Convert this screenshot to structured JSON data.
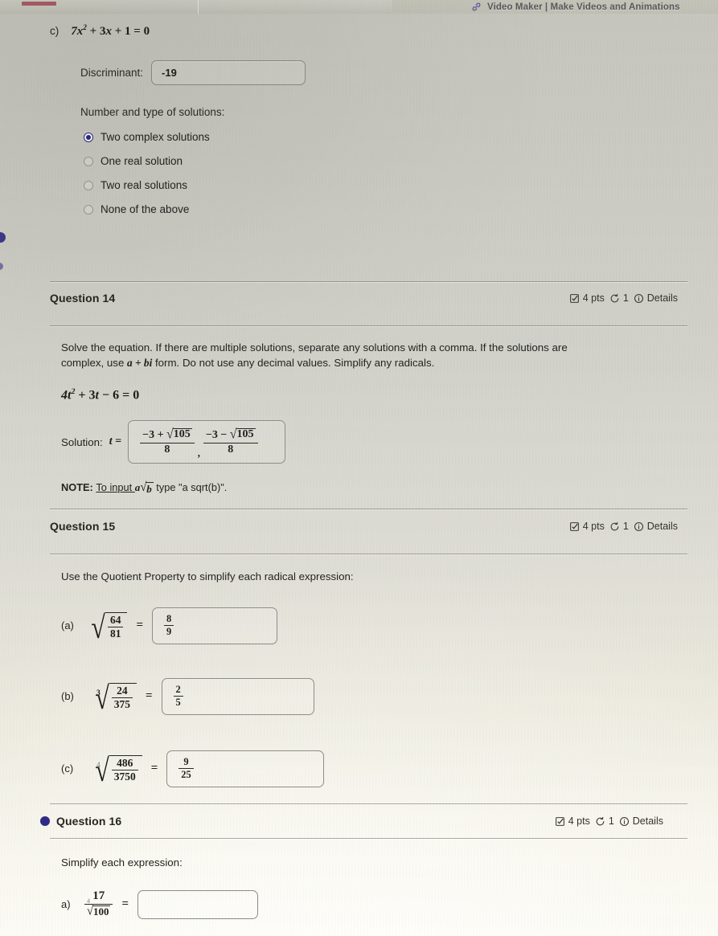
{
  "topbar": {
    "title": "Video Maker | Make Videos and Animations",
    "link_icon": "link-icon"
  },
  "part_c": {
    "label": "c)",
    "equation": {
      "coef_a": "7",
      "var": "x",
      "exponent": "2",
      "term_b": "+ 3",
      "var_b": "x",
      "term_c": "+ 1",
      "equals": "= 0"
    },
    "equation_text": "7x² + 3x + 1 = 0",
    "discriminant_label": "Discriminant:",
    "discriminant_value": "-19",
    "solutions_prompt": "Number and type of solutions:",
    "options": [
      {
        "label": "Two complex solutions",
        "selected": true
      },
      {
        "label": "One real solution",
        "selected": false
      },
      {
        "label": "Two real solutions",
        "selected": false
      },
      {
        "label": "None of the above",
        "selected": false
      }
    ]
  },
  "meta": {
    "points": "4 pts",
    "attempts": "1",
    "details": "Details",
    "check_icon": "checkbox-icon",
    "retry_icon": "circular-arrow-icon",
    "info_icon": "info-circle-icon"
  },
  "question14": {
    "title": "Question 14",
    "prompt_line1": "Solve the equation.  If there are multiple solutions, separate any solutions with a comma.  If the solutions are",
    "prompt_line2_pre": "complex, use ",
    "prompt_line2_math": "a + bi",
    "prompt_line2_post": " form.  Do not use any decimal values.  Simplify any radicals.",
    "equation": "4t² + 3t − 6 = 0",
    "equation_parts": {
      "a": "4",
      "t": "t",
      "exp": "2",
      "b": "+ 3",
      "t2": "t",
      "c": "− 6",
      "eq": "= 0"
    },
    "solution_label": "Solution:",
    "solution_var": "t =",
    "solution_value": "(−3 + √105)/8 , (−3 − √105)/8",
    "solution_first": {
      "num_pre": "−3 +",
      "num_radicand": "105",
      "den": "8"
    },
    "solution_second": {
      "num_pre": "−3 −",
      "num_radicand": "105",
      "den": "8"
    },
    "comma": ",",
    "note_pre": "NOTE: ",
    "note_mid": "To input ",
    "note_math_a": "a",
    "note_math_b": "b",
    "note_post": " type \"a sqrt(b)\"."
  },
  "question15": {
    "title": "Question 15",
    "prompt": "Use the Quotient Property to simplify each radical expression:",
    "parts": [
      {
        "label": "(a)",
        "index": "",
        "index_faint": false,
        "numerator": "64",
        "denominator": "81",
        "answer_num": "8",
        "answer_den": "9"
      },
      {
        "label": "(b)",
        "index": "3",
        "index_faint": false,
        "numerator": "24",
        "denominator": "375",
        "answer_num": "2",
        "answer_den": "5"
      },
      {
        "label": "(c)",
        "index": "4",
        "index_faint": true,
        "numerator": "486",
        "denominator": "3750",
        "answer_num": "9",
        "answer_den": "25"
      }
    ]
  },
  "question16": {
    "title": "Question 16",
    "prompt": "Simplify each expression:",
    "parts": [
      {
        "label": "a)",
        "numerator": "17",
        "index": "4",
        "index_faint": true,
        "radicand": "100",
        "answer": ""
      }
    ]
  }
}
